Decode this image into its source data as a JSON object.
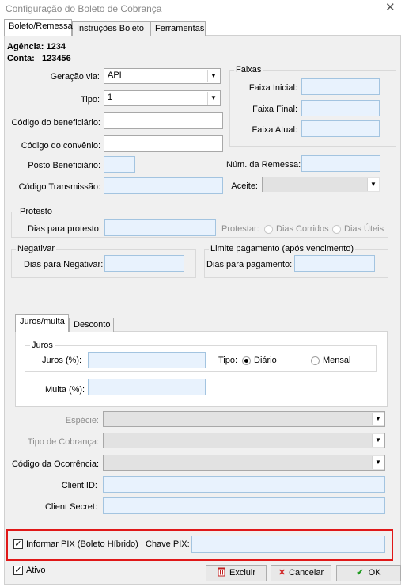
{
  "window": {
    "title": "Configuração do Boleto de Cobrança",
    "close": "✕"
  },
  "tabs": [
    "Boleto/Remessa",
    "Instruções Boleto",
    "Ferramentas"
  ],
  "account": {
    "agencia": "Agência: 1234",
    "conta_label": "Conta:",
    "conta_value": "123456"
  },
  "fields": {
    "geracao_via": {
      "label": "Geração via:",
      "value": "API"
    },
    "tipo": {
      "label": "Tipo:",
      "value": "1"
    },
    "codigo_beneficiario": "Código do beneficiário:",
    "codigo_convenio": "Código do convênio:",
    "posto_beneficiario": "Posto Beneficiário:",
    "codigo_transmissao": "Código Transmissão:",
    "num_remessa": "Núm. da Remessa:",
    "aceite": "Aceite:"
  },
  "faixas": {
    "title": "Faixas",
    "inicial": "Faixa Inicial:",
    "final": "Faixa Final:",
    "atual": "Faixa Atual:"
  },
  "protesto": {
    "title": "Protesto",
    "dias": "Dias para protesto:",
    "protestar": "Protestar:",
    "corridos": "Dias Corridos",
    "uteis": "Dias Úteis"
  },
  "negativar": {
    "title": "Negativar",
    "dias": "Dias para Negativar:"
  },
  "limite": {
    "title": "Limite pagamento (após vencimento)",
    "dias": "Dias para pagamento:"
  },
  "inner_tabs": [
    "Juros/multa",
    "Desconto"
  ],
  "juros": {
    "title": "Juros",
    "label": "Juros (%):",
    "tipo": "Tipo:",
    "diario": "Diário",
    "mensal": "Mensal",
    "multa": "Multa (%):"
  },
  "bottom": {
    "especie": "Espécie:",
    "tipo_cobranca": "Tipo de Cobrança:",
    "codigo_ocorrencia": "Código da Ocorrência:",
    "client_id": "Client ID:",
    "client_secret": "Client Secret:"
  },
  "pix": {
    "checkbox": "Informar PIX (Boleto Híbrido)",
    "chave": "Chave PIX:"
  },
  "ativo": "Ativo",
  "buttons": {
    "excluir": "Excluir",
    "cancelar": "Cancelar",
    "ok": "OK"
  },
  "icons": {
    "checkmark": "✓",
    "dropdown": "▼",
    "cancel_x": "✕",
    "ok_check": "✔"
  },
  "colors": {
    "field_bg": "#e8f2fd",
    "highlight": "#e01818",
    "ok_green": "#1e9a1e",
    "cancel_red": "#d02020"
  }
}
